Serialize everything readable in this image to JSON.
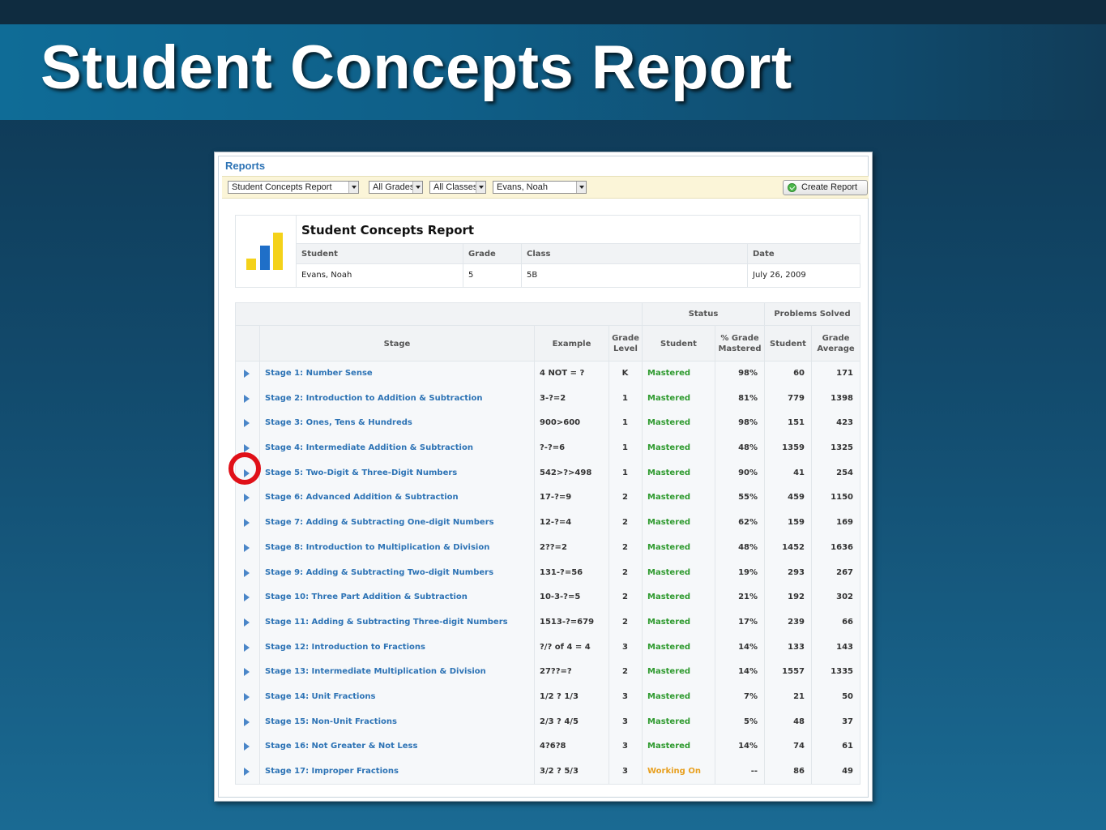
{
  "slide": {
    "title": "Student Concepts Report"
  },
  "app": {
    "section_label": "Reports",
    "filters": {
      "report": "Student Concepts Report",
      "grades": "All Grades",
      "classes": "All Classes",
      "student": "Evans, Noah"
    },
    "create_button": "Create Report"
  },
  "report": {
    "title": "Student Concepts Report",
    "headers": {
      "student": "Student",
      "grade": "Grade",
      "class": "Class",
      "date": "Date"
    },
    "values": {
      "student": "Evans, Noah",
      "grade": "5",
      "class": "5B",
      "date": "July 26, 2009"
    }
  },
  "table": {
    "groups": {
      "status": "Status",
      "problems": "Problems Solved"
    },
    "columns": {
      "stage": "Stage",
      "example": "Example",
      "grade_level": "Grade Level",
      "student": "Student",
      "pct_mastered": "% Grade Mastered",
      "solved_student": "Student",
      "grade_average": "Grade Average"
    },
    "rows": [
      {
        "stage": "Stage 1: Number Sense",
        "example": "4 NOT = ?",
        "grade": "K",
        "status": "Mastered",
        "pct": "98%",
        "student": "60",
        "avg": "171"
      },
      {
        "stage": "Stage 2: Introduction to Addition & Subtraction",
        "example": "3-?=2",
        "grade": "1",
        "status": "Mastered",
        "pct": "81%",
        "student": "779",
        "avg": "1398"
      },
      {
        "stage": "Stage 3: Ones, Tens & Hundreds",
        "example": "900>600",
        "grade": "1",
        "status": "Mastered",
        "pct": "98%",
        "student": "151",
        "avg": "423"
      },
      {
        "stage": "Stage 4: Intermediate Addition & Subtraction",
        "example": "?-?=6",
        "grade": "1",
        "status": "Mastered",
        "pct": "48%",
        "student": "1359",
        "avg": "1325"
      },
      {
        "stage": "Stage 5: Two-Digit & Three-Digit Numbers",
        "example": "542>?>498",
        "grade": "1",
        "status": "Mastered",
        "pct": "90%",
        "student": "41",
        "avg": "254"
      },
      {
        "stage": "Stage 6: Advanced Addition & Subtraction",
        "example": "17-?=9",
        "grade": "2",
        "status": "Mastered",
        "pct": "55%",
        "student": "459",
        "avg": "1150"
      },
      {
        "stage": "Stage 7: Adding & Subtracting One-digit Numbers",
        "example": "12-?=4",
        "grade": "2",
        "status": "Mastered",
        "pct": "62%",
        "student": "159",
        "avg": "169"
      },
      {
        "stage": "Stage 8: Introduction to Multiplication & Division",
        "example": "2??=2",
        "grade": "2",
        "status": "Mastered",
        "pct": "48%",
        "student": "1452",
        "avg": "1636"
      },
      {
        "stage": "Stage 9: Adding & Subtracting Two-digit Numbers",
        "example": "131-?=56",
        "grade": "2",
        "status": "Mastered",
        "pct": "19%",
        "student": "293",
        "avg": "267"
      },
      {
        "stage": "Stage 10: Three Part Addition & Subtraction",
        "example": "10-3-?=5",
        "grade": "2",
        "status": "Mastered",
        "pct": "21%",
        "student": "192",
        "avg": "302"
      },
      {
        "stage": "Stage 11: Adding & Subtracting Three-digit Numbers",
        "example": "1513-?=679",
        "grade": "2",
        "status": "Mastered",
        "pct": "17%",
        "student": "239",
        "avg": "66"
      },
      {
        "stage": "Stage 12: Introduction to Fractions",
        "example": "?/? of 4 = 4",
        "grade": "3",
        "status": "Mastered",
        "pct": "14%",
        "student": "133",
        "avg": "143"
      },
      {
        "stage": "Stage 13: Intermediate Multiplication & Division",
        "example": "27??=?",
        "grade": "2",
        "status": "Mastered",
        "pct": "14%",
        "student": "1557",
        "avg": "1335"
      },
      {
        "stage": "Stage 14: Unit Fractions",
        "example": "1/2 ? 1/3",
        "grade": "3",
        "status": "Mastered",
        "pct": "7%",
        "student": "21",
        "avg": "50"
      },
      {
        "stage": "Stage 15: Non-Unit Fractions",
        "example": "2/3 ? 4/5",
        "grade": "3",
        "status": "Mastered",
        "pct": "5%",
        "student": "48",
        "avg": "37"
      },
      {
        "stage": "Stage 16: Not Greater & Not Less",
        "example": "4?6?8",
        "grade": "3",
        "status": "Mastered",
        "pct": "14%",
        "student": "74",
        "avg": "61"
      },
      {
        "stage": "Stage 17: Improper Fractions",
        "example": "3/2 ? 5/3",
        "grade": "3",
        "status": "Working On",
        "pct": "--",
        "student": "86",
        "avg": "49"
      }
    ]
  },
  "colors": {
    "mastered": "#2e9a2e",
    "working_on": "#e8a020",
    "link": "#2d73b5",
    "callout": "#e01018"
  },
  "icons": {
    "expand": "triangle-right-icon",
    "logo": "bar-chart-logo-icon",
    "create": "check-circle-icon"
  }
}
